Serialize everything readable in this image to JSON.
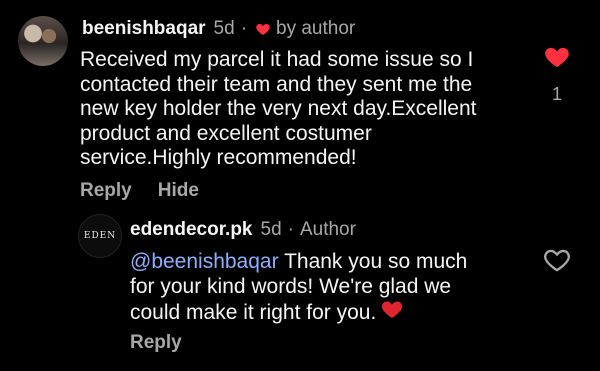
{
  "comment": {
    "username": "beenishbaqar",
    "time": "5d",
    "liked_by_author_label": "by author",
    "text": "Received my parcel it had some issue so I contacted their team and they sent me the new key holder the very next day.Excellent product and excellent costumer service.Highly recommended!",
    "lines": [
      "Received my parcel it had some issue so I",
      "contacted their team and they sent me the",
      "new key holder the very next day.Excellent",
      "product and excellent costumer",
      "service.Highly recommended!"
    ],
    "actions": {
      "reply": "Reply",
      "hide": "Hide"
    },
    "like_count": "1",
    "liked": true
  },
  "reply": {
    "username": "edendecor.pk",
    "time": "5d",
    "role": "Author",
    "avatar_text": "EDEN",
    "mention": "@beenishbaqar",
    "lines": [
      "Thank you so much",
      "for your kind words! We're glad we",
      "could make it right for you."
    ],
    "emoji": "red-heart",
    "actions": {
      "reply": "Reply"
    },
    "liked": false
  },
  "colors": {
    "background": "#000000",
    "text": "#f5f5f5",
    "muted": "#a8a8a8",
    "mention": "#8ab0ff",
    "heart": "#ff3040"
  }
}
